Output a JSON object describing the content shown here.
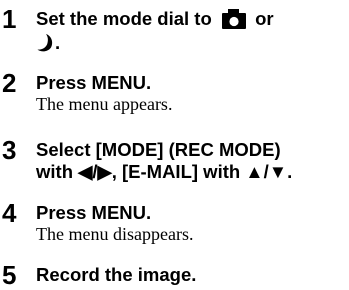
{
  "steps": [
    {
      "number": "1",
      "title_before_icon": "Set the mode dial to",
      "title_after_icon": "or",
      "title_line2_after_icon": ".",
      "icons": [
        "camera-mode-icon",
        "night-mode-icon"
      ]
    },
    {
      "number": "2",
      "title": "Press MENU.",
      "description": "The menu appears."
    },
    {
      "number": "3",
      "title_line1": "Select [MODE] (REC MODE)",
      "title_line2": "with ◀/▶, [E-MAIL] with ▲/▼."
    },
    {
      "number": "4",
      "title": "Press MENU.",
      "description": "The menu disappears."
    },
    {
      "number": "5",
      "title": "Record the image."
    }
  ]
}
